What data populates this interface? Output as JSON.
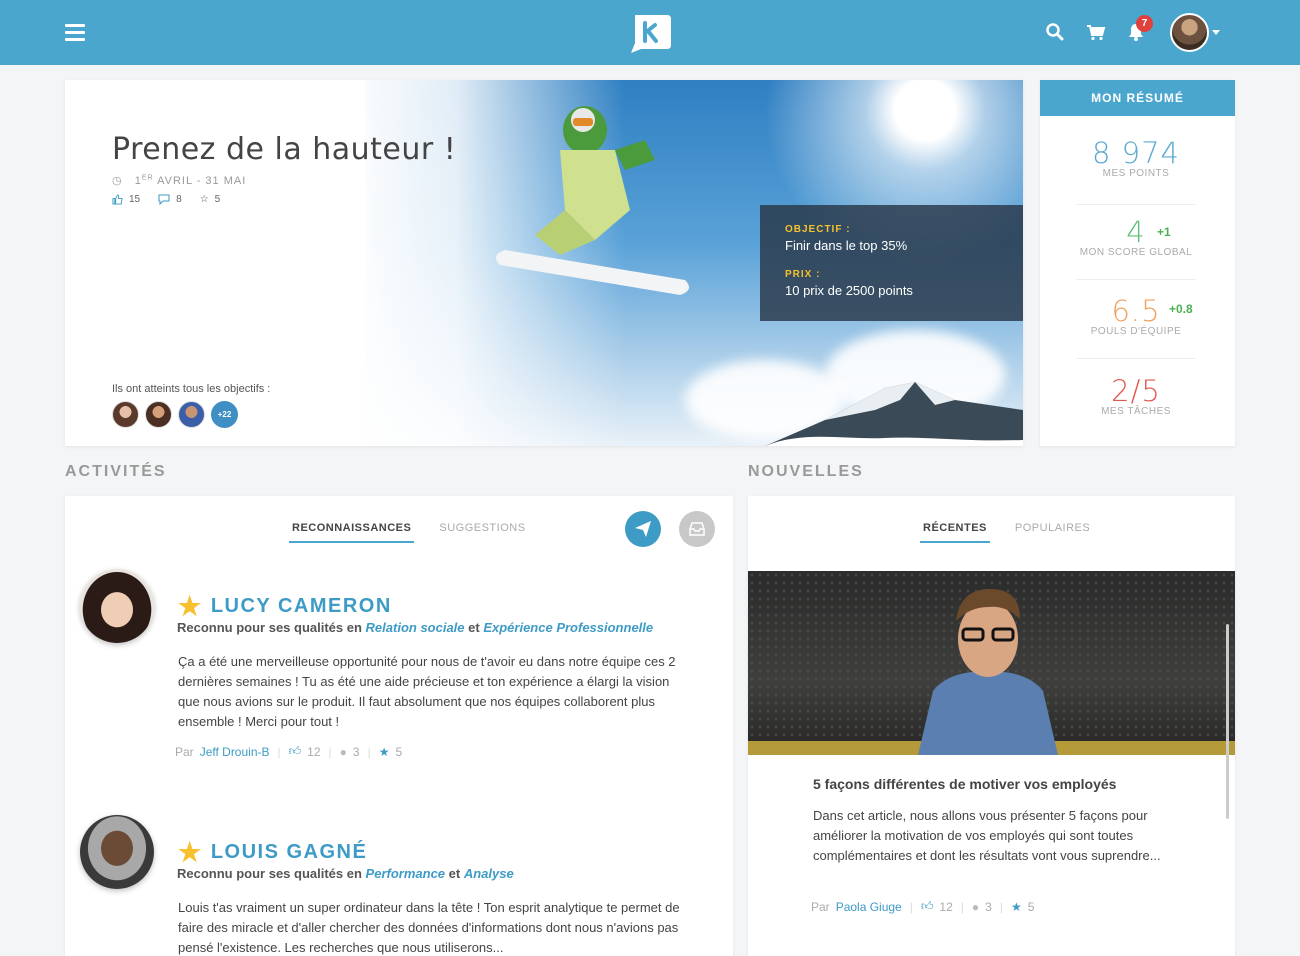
{
  "topbar": {
    "notification_count": "7",
    "icons": [
      "menu-icon",
      "search-icon",
      "cart-icon",
      "bell-icon"
    ],
    "accent": "#4ba6ce"
  },
  "hero": {
    "title": "Prenez de la hauteur !",
    "date_prefix": "1",
    "date_sup": "ER",
    "date_rest": " AVRIL - 31 MAI",
    "likes": "15",
    "comments": "8",
    "stars": "5",
    "achievers_label": "Ils ont atteints tous les objectifs :",
    "achievers_more": "+22",
    "objective_label": "OBJECTIF :",
    "objective_value": "Finir dans le top 35%",
    "prize_label": "PRIX :",
    "prize_value": "10 prix de 2500 points"
  },
  "summary": {
    "title": "MON RÉSUMÉ",
    "items": [
      {
        "value": "8 974",
        "label": "MES POINTS",
        "delta": "",
        "color": "#5aa9d0"
      },
      {
        "value": "4",
        "label": "MON SCORE GLOBAL",
        "delta": "+1",
        "color": "#5fbf7a"
      },
      {
        "value": "6.5",
        "label": "POULS D'ÉQUIPE",
        "delta": "+0.8",
        "color": "#f0a05a"
      },
      {
        "value": "2/5",
        "label": "MES TÂCHES",
        "delta": "",
        "color": "#e0584c"
      }
    ]
  },
  "activities": {
    "section_title": "ACTIVITÉS",
    "tabs": [
      "RECONNAISSANCES",
      "SUGGESTIONS"
    ],
    "items": [
      {
        "name": "LUCY CAMERON",
        "sub_prefix": "Reconnu pour ses qualités en ",
        "quality1": "Relation sociale",
        "joiner": " et ",
        "quality2": "Expérience Professionnelle",
        "text": "Ça a été une merveilleuse opportunité pour nous de t'avoir eu dans notre équipe ces 2 dernières semaines ! Tu as été une aide précieuse et ton expérience a élargi la vision que nous avions sur le produit. Il faut absolument que nos équipes collaborent plus ensemble ! Merci pour tout !",
        "by": "Par",
        "author": "Jeff Drouin-B",
        "likes": "12",
        "comments": "3",
        "stars": "5"
      },
      {
        "name": "LOUIS GAGNÉ",
        "sub_prefix": "Reconnu pour ses qualités en ",
        "quality1": "Performance",
        "joiner": " et ",
        "quality2": "Analyse",
        "text": "Louis t'as vraiment un super ordinateur dans la tête ! Ton esprit analytique te permet de faire des miracle et d'aller chercher des données d'informations dont nous n'avions pas pensé l'existence. Les recherches que nous utiliserons..."
      }
    ]
  },
  "news": {
    "section_title": "NOUVELLES",
    "tabs": [
      "RÉCENTES",
      "POPULAIRES"
    ],
    "article": {
      "title": "5 façons différentes de motiver vos employés",
      "text": "Dans cet article, nous allons vous présenter 5 façons pour améliorer la motivation de vos employés qui sont toutes complémentaires et dont les résultats vont vous suprendre...",
      "by": "Par",
      "author": "Paola Giuge",
      "likes": "12",
      "comments": "3",
      "stars": "5"
    }
  }
}
